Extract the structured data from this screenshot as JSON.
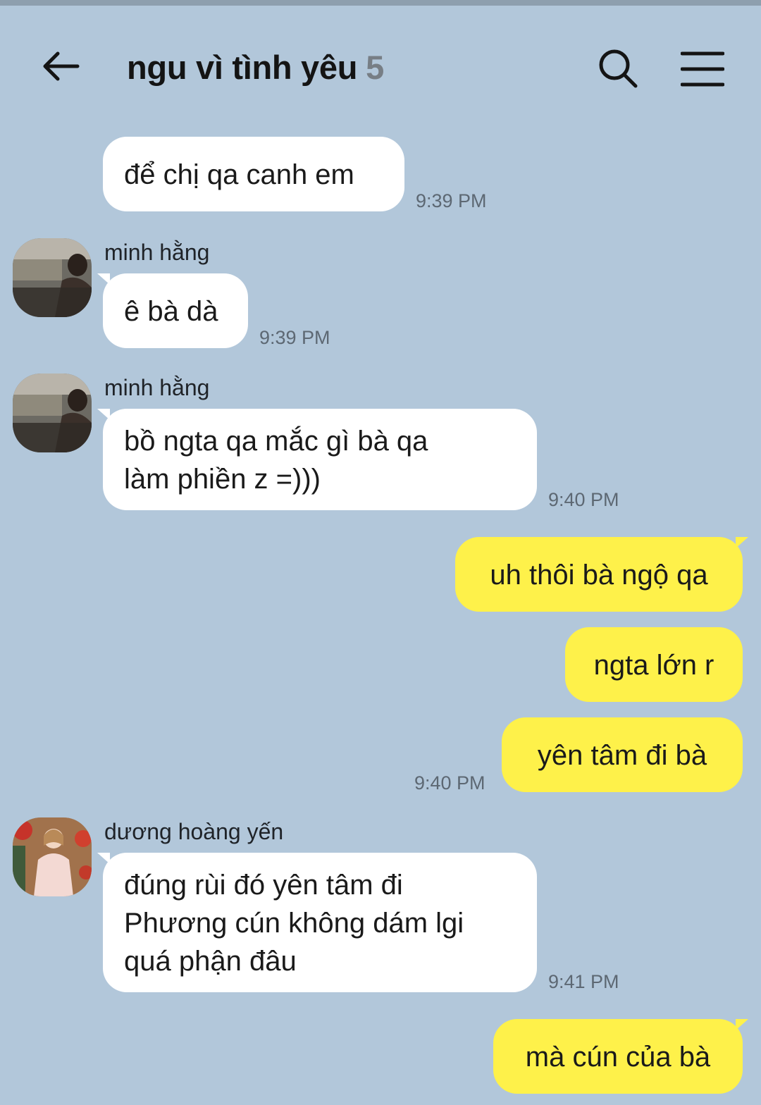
{
  "header": {
    "title": "ngu vì tình yêu",
    "member_count": "5",
    "back_icon": "back-arrow-icon",
    "search_icon": "search-icon",
    "menu_icon": "hamburger-menu-icon"
  },
  "colors": {
    "background": "#b2c7da",
    "incoming_bubble": "#ffffff",
    "outgoing_bubble": "#fef14a"
  },
  "messages": [
    {
      "text": "để chị qa canh em",
      "time": "9:39 PM"
    },
    {
      "sender": "minh hằng",
      "text": "ê bà dà",
      "time": "9:39 PM"
    },
    {
      "sender": "minh hằng",
      "text": "bồ ngta qa mắc gì bà qa\nlàm phiền z =)))",
      "time": "9:40 PM"
    },
    {
      "text": "uh thôi bà ngộ qa"
    },
    {
      "text": "ngta lớn r"
    },
    {
      "text": "yên tâm đi bà",
      "time": "9:40 PM"
    },
    {
      "sender": "dương hoàng yến",
      "text": "đúng rùi đó yên tâm đi\nPhương cún không dám lgi\nquá phận đâu",
      "time": "9:41 PM"
    },
    {
      "text": "mà cún của bà"
    }
  ]
}
